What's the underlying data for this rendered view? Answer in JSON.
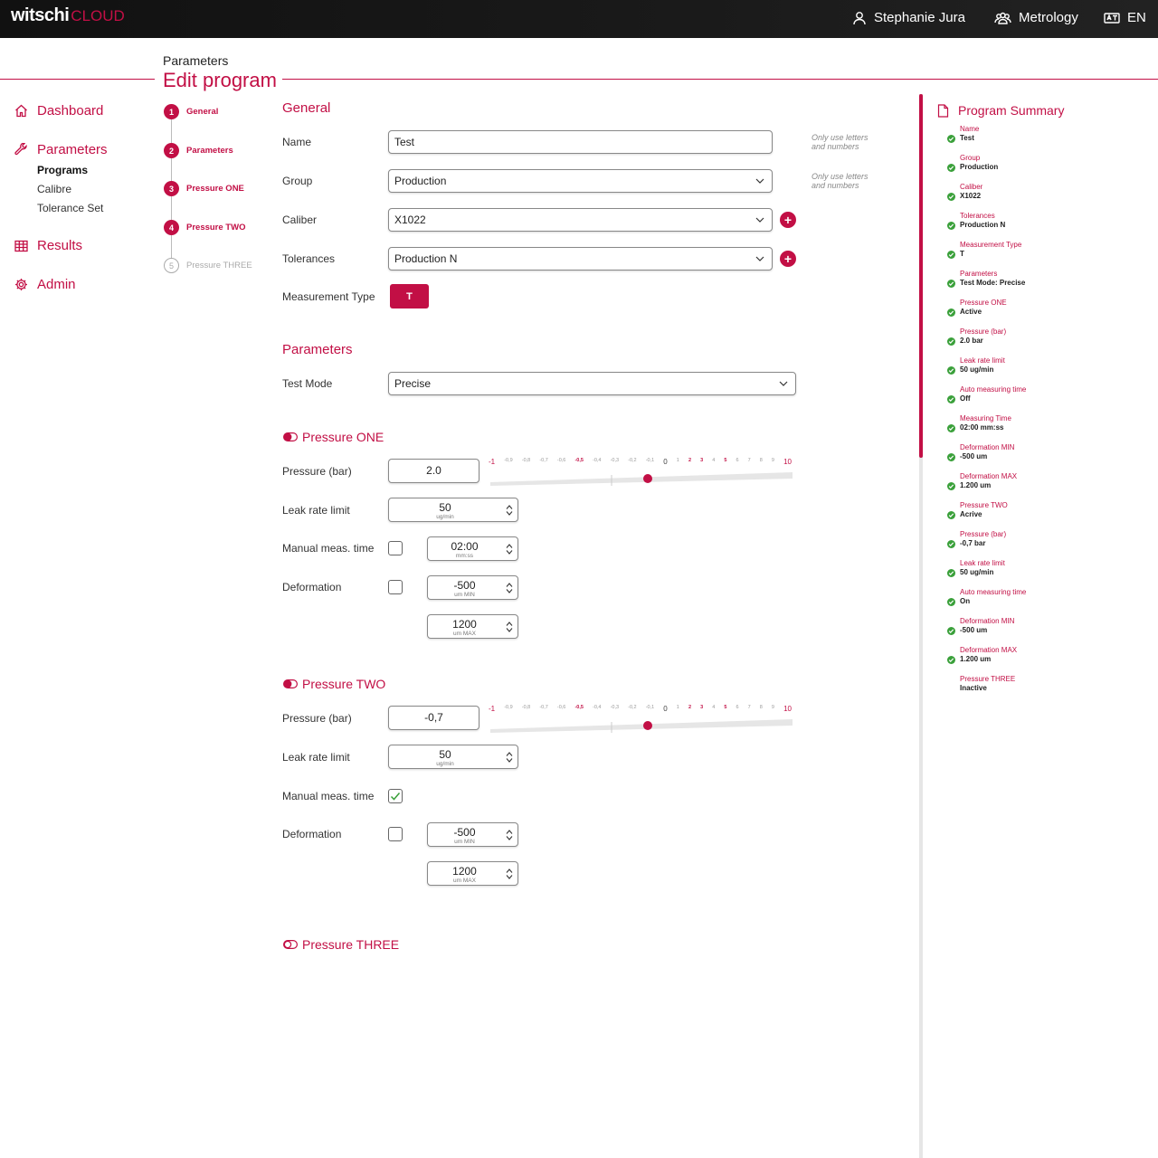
{
  "brand": {
    "name": "witschi",
    "product": "CLOUD"
  },
  "topbar": {
    "user": "Stephanie Jura",
    "workspace": "Metrology",
    "language": "EN"
  },
  "header": {
    "section": "Parameters",
    "title": "Edit program"
  },
  "sidebar": {
    "items": [
      {
        "label": "Dashboard",
        "icon": "home-icon"
      },
      {
        "label": "Parameters",
        "icon": "wrench-icon",
        "children": [
          "Programs",
          "Calibre",
          "Tolerance Set"
        ]
      },
      {
        "label": "Results",
        "icon": "table-icon"
      },
      {
        "label": "Admin",
        "icon": "gear-icon"
      }
    ]
  },
  "steps": [
    {
      "num": "1",
      "label": "General",
      "active": true
    },
    {
      "num": "2",
      "label": "Parameters",
      "active": true
    },
    {
      "num": "3",
      "label": "Pressure ONE",
      "active": true
    },
    {
      "num": "4",
      "label": "Pressure TWO",
      "active": true
    },
    {
      "num": "5",
      "label": "Pressure THREE",
      "active": false
    }
  ],
  "general": {
    "title": "General",
    "name_label": "Name",
    "name_value": "Test",
    "group_label": "Group",
    "group_value": "Production",
    "caliber_label": "Caliber",
    "caliber_value": "X1022",
    "tolerances_label": "Tolerances",
    "tolerances_value": "Production N",
    "mtype_label": "Measurement Type",
    "mtype_value": "T",
    "hint": "Only use letters and numbers"
  },
  "parameters": {
    "title": "Parameters",
    "test_mode_label": "Test Mode",
    "test_mode_value": "Precise"
  },
  "pressure_one": {
    "title": "Pressure ONE",
    "pressure_label": "Pressure (bar)",
    "pressure_value": "2.0",
    "leak_label": "Leak rate limit",
    "leak_value": "50",
    "leak_unit": "ug/min",
    "manual_label": "Manual meas. time",
    "manual_checked": false,
    "time_value": "02:00",
    "time_unit": "mm:ss",
    "deformation_label": "Deformation",
    "deformation_checked": false,
    "def_min_value": "-500",
    "def_min_unit": "um MIN",
    "def_max_value": "1200",
    "def_max_unit": "um MAX",
    "slider_level": 2
  },
  "pressure_two": {
    "title": "Pressure TWO",
    "pressure_label": "Pressure (bar)",
    "pressure_value": "-0,7",
    "leak_label": "Leak rate limit",
    "leak_value": "50",
    "leak_unit": "ug/min",
    "manual_label": "Manual meas. time",
    "manual_checked": true,
    "deformation_label": "Deformation",
    "deformation_checked": false,
    "def_min_value": "-500",
    "def_min_unit": "um MIN",
    "def_max_value": "1200",
    "def_max_unit": "um MAX",
    "slider_level": 2
  },
  "pressure_three": {
    "title": "Pressure THREE"
  },
  "slider_ticks": [
    "-1",
    "-0,9",
    "-0,8",
    "-0,7",
    "-0,6",
    "-0,5",
    "-0,4",
    "-0,3",
    "-0,2",
    "-0,1",
    "0",
    "1",
    "2",
    "3",
    "4",
    "5",
    "6",
    "7",
    "8",
    "9",
    "10"
  ],
  "summary": {
    "title": "Program Summary",
    "items": [
      {
        "label": "Name",
        "value": "Test",
        "ok": true
      },
      {
        "label": "Group",
        "value": "Production",
        "ok": true
      },
      {
        "label": "Caliber",
        "value": "X1022",
        "ok": true
      },
      {
        "label": "Tolerances",
        "value": "Production N",
        "ok": true
      },
      {
        "label": "Measurement Type",
        "value": "T",
        "ok": true
      },
      {
        "label": "Parameters",
        "value": "Test Mode: Precise",
        "ok": true
      },
      {
        "label": "Pressure ONE",
        "value": "Active",
        "ok": true
      },
      {
        "label": "Pressure (bar)",
        "value": "2.0 bar",
        "ok": true
      },
      {
        "label": "Leak rate limit",
        "value": "50 ug/min",
        "ok": true
      },
      {
        "label": "Auto measuring time",
        "value": "Off",
        "ok": true
      },
      {
        "label": "Measuring Time",
        "value": "02:00 mm:ss",
        "ok": true
      },
      {
        "label": "Deformation MIN",
        "value": "-500 um",
        "ok": true
      },
      {
        "label": "Deformation MAX",
        "value": "1.200 um",
        "ok": true
      },
      {
        "label": "Pressure TWO",
        "value": "Acrive",
        "ok": true
      },
      {
        "label": "Pressure (bar)",
        "value": "-0,7 bar",
        "ok": true
      },
      {
        "label": "Leak rate limit",
        "value": "50 ug/min",
        "ok": true
      },
      {
        "label": "Auto measuring time",
        "value": "On",
        "ok": true
      },
      {
        "label": "Deformation MIN",
        "value": "-500 um",
        "ok": true
      },
      {
        "label": "Deformation MAX",
        "value": "1.200 um",
        "ok": true
      },
      {
        "label": "Pressure THREE",
        "value": "Inactive",
        "ok": false
      }
    ]
  },
  "colors": {
    "accent": "#c20f45",
    "ok": "#3aa03a",
    "topbar": "#111111"
  }
}
